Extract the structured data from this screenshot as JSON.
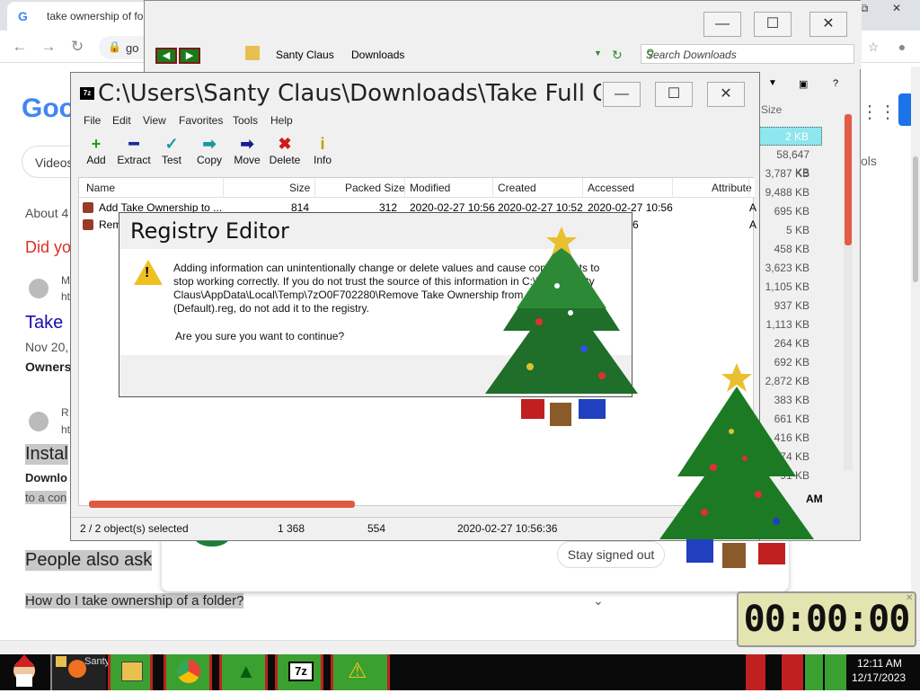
{
  "chrome": {
    "tab_title": "take ownership of fold",
    "url_partial": "go",
    "google_logo": "Goo",
    "videos_chip": "Videos",
    "tools_label": "ols",
    "about_text": "About 4",
    "did_you_mean": "Did yo",
    "result_letter_m": "M",
    "result_ht": "ht",
    "take_link": "Take",
    "date_text": "Nov 20,",
    "owners_text": "Owners",
    "result_r": "R",
    "result_ht2": "ht",
    "install_text": "Instal",
    "download_text": "Downlo",
    "to_a_con": "to a con",
    "people_also_ask": "People also ask",
    "question_1": "How do I take ownership of a folder?",
    "stay_signed_out": "Stay signed out"
  },
  "explorer": {
    "crumbs": [
      "Santy Claus",
      "Downloads"
    ],
    "search_placeholder": "Search Downloads",
    "size_header": "Size",
    "sizes": [
      "2 KB",
      "58,647 KB",
      "3,787 KB",
      "9,488 KB",
      "695 KB",
      "5 KB",
      "458 KB",
      "3,623 KB",
      "1,105 KB",
      "937 KB",
      "1,113 KB",
      "264 KB",
      "692 KB",
      "2,872 KB",
      "383 KB",
      "661 KB",
      "416 KB",
      "1,174 KB",
      "91 KB"
    ],
    "am_label": "AM",
    "help_mark": "?"
  },
  "sevenzip": {
    "title": "C:\\Users\\Santy Claus\\Downloads\\Take Full O...",
    "menu": [
      "File",
      "Edit",
      "View",
      "Favorites",
      "Tools",
      "Help"
    ],
    "toolbar": [
      {
        "label": "Add",
        "icon": "+",
        "color": "#1aa01a"
      },
      {
        "label": "Extract",
        "icon": "━",
        "color": "#1a2aa0"
      },
      {
        "label": "Test",
        "icon": "✓",
        "color": "#1a9aa0"
      },
      {
        "label": "Copy",
        "icon": "➡",
        "color": "#1a9a9a"
      },
      {
        "label": "Move",
        "icon": "➡",
        "color": "#1a1a90"
      },
      {
        "label": "Delete",
        "icon": "✖",
        "color": "#d01a1a"
      },
      {
        "label": "Info",
        "icon": "i",
        "color": "#c0a000"
      }
    ],
    "columns": [
      "Name",
      "Size",
      "Packed Size",
      "Modified",
      "Created",
      "Accessed",
      "Attribute"
    ],
    "rows": [
      {
        "name": "Add Take Ownership to ...",
        "size": "814",
        "packed": "312",
        "modified": "2020-02-27 10:56",
        "created": "2020-02-27 10:52",
        "accessed": "2020-02-27 10:56",
        "attr": "A"
      },
      {
        "name": "Remove...",
        "size": "",
        "packed": "",
        "modified": "",
        "created": "",
        "accessed": "...27 10:56",
        "attr": "A"
      }
    ],
    "status": {
      "selected": "2 / 2 object(s) selected",
      "size": "1 368",
      "packed": "554",
      "date": "2020-02-27 10:56:36"
    }
  },
  "registry_dialog": {
    "title": "Registry Editor",
    "message": "Adding information can unintentionally change or delete values and cause components to stop working correctly. If you do not trust the source of this information in C:\\Users\\Santy Claus\\AppData\\Local\\Temp\\7zO0F702280\\Remove Take Ownership from Context Menu (Default).reg, do not add it to the registry.",
    "question": "Are you sure you want to continue?"
  },
  "timer": {
    "display": "00:00:00"
  },
  "taskbar": {
    "time": "12:11 AM",
    "date": "12/17/2023",
    "task_label": "Santy"
  },
  "colors": {
    "accent_green": "#3aa030",
    "accent_red": "#c02020",
    "selection": "#8ee6ee"
  }
}
